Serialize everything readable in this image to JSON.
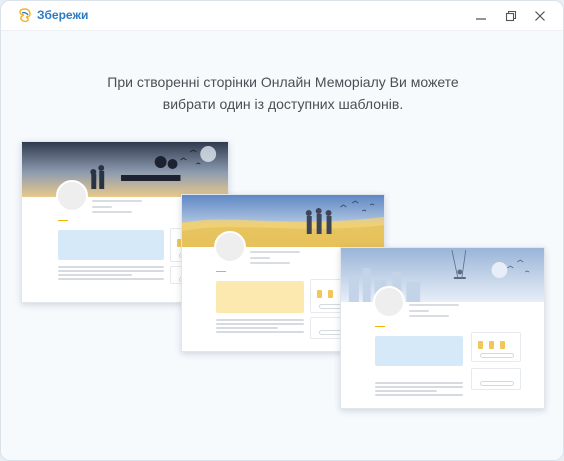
{
  "app": {
    "logo_text": "Збережи",
    "brand_color": "#2b7bc4",
    "window_controls": [
      "minimize-icon",
      "restore-icon",
      "close-icon"
    ]
  },
  "intro": {
    "line1": "При створенні сторінки Онлайн Меморіалу Ви можете",
    "line2": "вибрати один із доступних шаблонів."
  },
  "templates": [
    {
      "name": "evening-sky",
      "quote_color": "#d6e9f8",
      "banner_colors": [
        "#2f3a4e",
        "#8d9bb0",
        "#e9c98c"
      ]
    },
    {
      "name": "flag-soldiers",
      "quote_color": "#fbe9b0",
      "banner_colors": [
        "#5f88c4",
        "#e8c561"
      ]
    },
    {
      "name": "swing-city",
      "quote_color": "#d6e9f8",
      "banner_colors": [
        "#9ab5d8",
        "#e7eef7"
      ]
    }
  ]
}
